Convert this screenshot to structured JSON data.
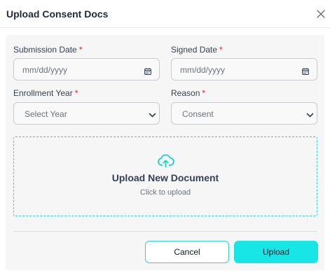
{
  "dialog": {
    "title": "Upload Consent Docs",
    "close_icon": "close-icon"
  },
  "form": {
    "required_marker": "*",
    "submission_date": {
      "label": "Submission Date",
      "placeholder": "mm/dd/yyyy",
      "icon": "calendar-icon"
    },
    "signed_date": {
      "label": "Signed Date",
      "placeholder": "mm/dd/yyyy",
      "icon": "calendar-icon"
    },
    "enrollment_year": {
      "label": "Enrollment Year",
      "value": "Select Year",
      "icon": "chevron-down-icon"
    },
    "reason": {
      "label": "Reason",
      "value": "Consent",
      "icon": "chevron-down-icon"
    }
  },
  "upload": {
    "icon": "cloud-upload-icon",
    "title": "Upload New Document",
    "subtitle": "Click to upload"
  },
  "actions": {
    "cancel_label": "Cancel",
    "upload_label": "Upload"
  },
  "colors": {
    "accent": "#18e6e6",
    "accent_border": "#2ad4d4",
    "required": "#e02424",
    "panel_bg": "#f6f6f6"
  }
}
